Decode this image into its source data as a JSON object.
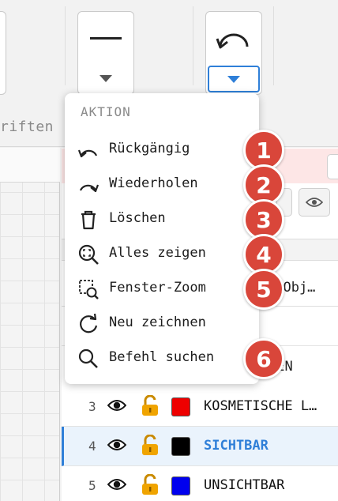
{
  "toolbar": {
    "section_label": "riften"
  },
  "menu": {
    "header": "AKTION",
    "items": [
      {
        "label": "Rückgängig",
        "icon": "undo-icon"
      },
      {
        "label": "Wiederholen",
        "icon": "redo-icon"
      },
      {
        "label": "Löschen",
        "icon": "trash-icon"
      },
      {
        "label": "Alles zeigen",
        "icon": "zoom-extents-icon"
      },
      {
        "label": "Fenster-Zoom",
        "icon": "window-zoom-icon"
      },
      {
        "label": "Neu zeichnen",
        "icon": "redraw-icon"
      },
      {
        "label": "Befehl suchen",
        "icon": "search-command-icon"
      }
    ]
  },
  "badges": [
    "1",
    "2",
    "3",
    "4",
    "5",
    "6"
  ],
  "panel": {
    "filter_text": "n Obj…",
    "hidden_layer_name": "IEN"
  },
  "layers": [
    {
      "num": "3",
      "name": "KOSMETISCHE L…",
      "color": "#ee0000"
    },
    {
      "num": "4",
      "name": "SICHTBAR",
      "color": "#000000"
    },
    {
      "num": "5",
      "name": "UNSICHTBAR",
      "color": "#0000ee"
    }
  ],
  "colors": {
    "accent": "#2f7fd8",
    "badge": "#d9463a",
    "lock": "#f0a400"
  }
}
